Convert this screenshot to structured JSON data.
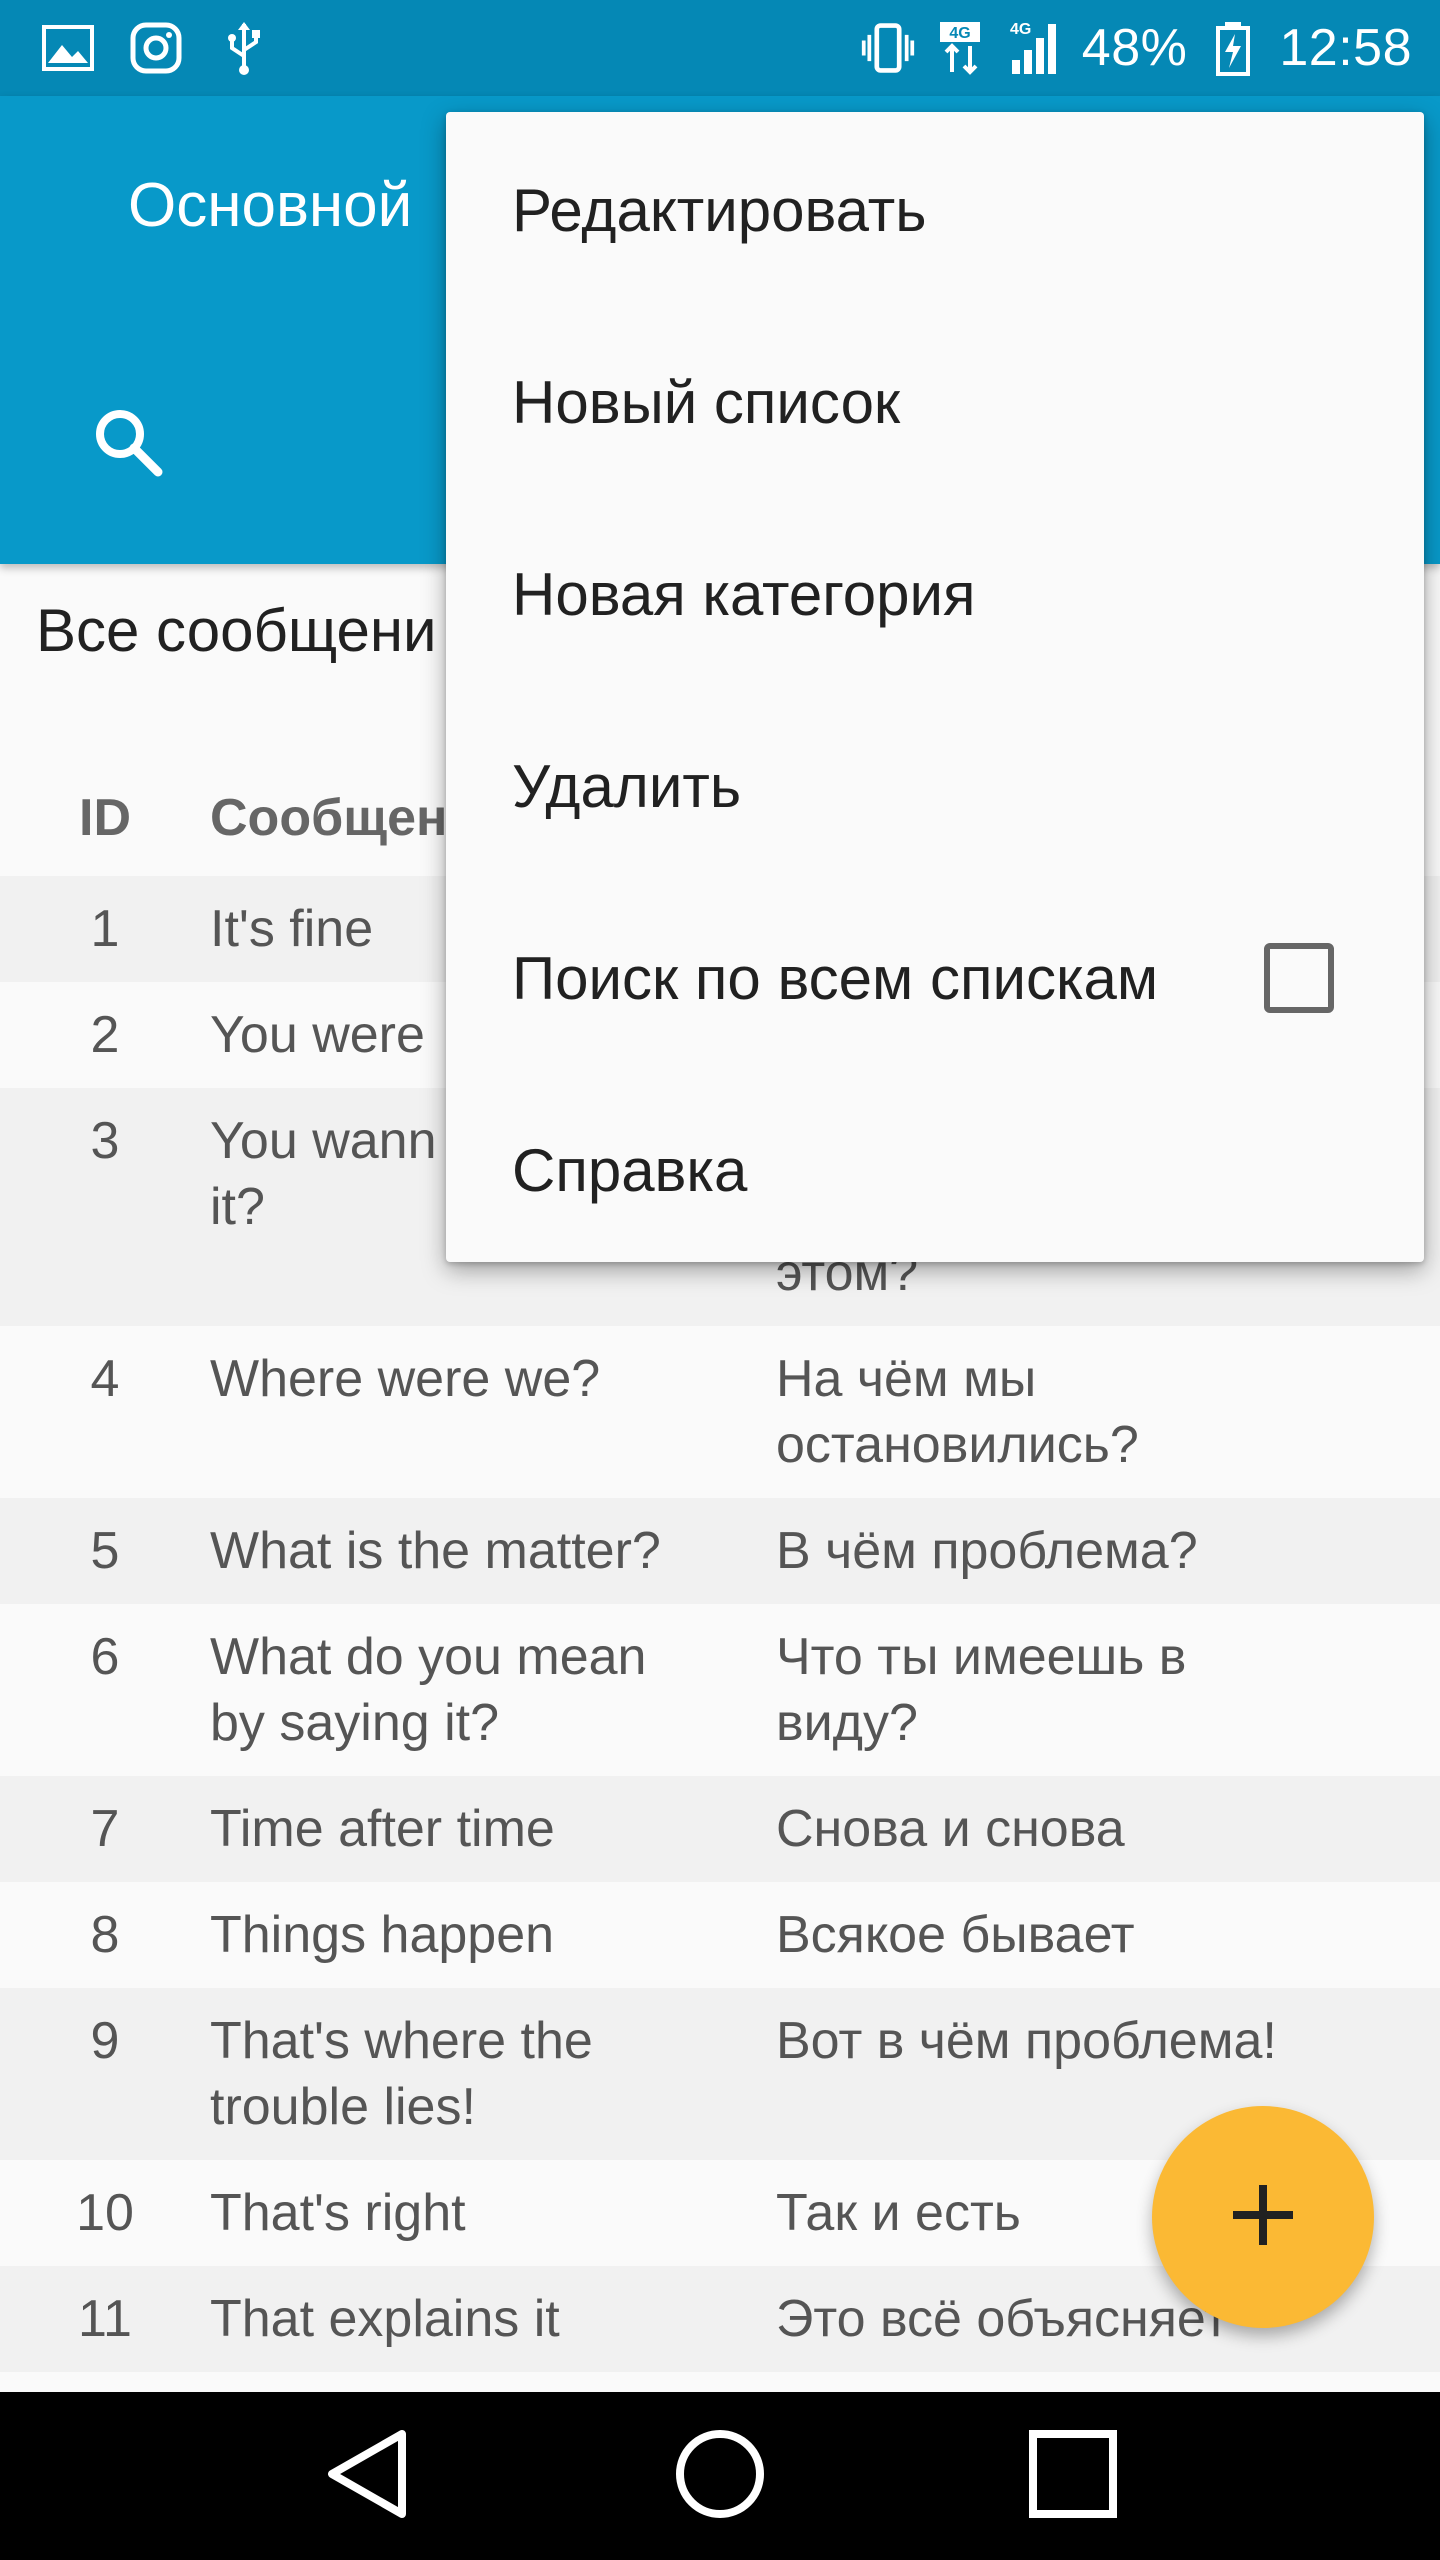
{
  "status_bar": {
    "battery_percent": "48%",
    "time": "12:58",
    "network_label": "4G",
    "left_icons": [
      "gallery-icon",
      "instagram-icon",
      "usb-icon"
    ],
    "right_icons": [
      "vibrate-icon",
      "data-transfer-icon",
      "signal-icon",
      "battery-charging-icon"
    ]
  },
  "app_bar": {
    "title": "Основной",
    "search_icon": "search-icon"
  },
  "content": {
    "section_heading": "Все сообщени",
    "table": {
      "headers": {
        "id": "ID",
        "message": "Сообщен"
      },
      "rows": [
        {
          "id": "1",
          "en": "It's fine",
          "ru": ""
        },
        {
          "id": "2",
          "en": "You were",
          "ru": ""
        },
        {
          "id": "3",
          "en": "You wann\nit?",
          "ru": "\n\nэтом?"
        },
        {
          "id": "4",
          "en": "Where were we?",
          "ru": "На чём мы\nостановились?"
        },
        {
          "id": "5",
          "en": "What is the matter?",
          "ru": "В чём проблема?"
        },
        {
          "id": "6",
          "en": "What do you mean\nby saying it?",
          "ru": "Что ты имеешь в\nвиду?"
        },
        {
          "id": "7",
          "en": "Time after time",
          "ru": "Снова и снова"
        },
        {
          "id": "8",
          "en": "Things happen",
          "ru": "Всякое бывает"
        },
        {
          "id": "9",
          "en": "That's where the\ntrouble lies!",
          "ru": "Вот в чём проблема!"
        },
        {
          "id": "10",
          "en": "That's right",
          "ru": "Так и есть"
        },
        {
          "id": "11",
          "en": "That explains it",
          "ru": "Это всё объясняет"
        }
      ]
    }
  },
  "menu": {
    "items": [
      {
        "label": "Редактировать"
      },
      {
        "label": "Новый список"
      },
      {
        "label": "Новая категория"
      },
      {
        "label": "Удалить"
      },
      {
        "label": "Поиск по всем спискам",
        "checkbox": true,
        "checked": false
      },
      {
        "label": "Справка"
      }
    ]
  },
  "fab": {
    "icon": "plus-icon"
  },
  "nav_bar": {
    "icons": [
      "back-icon",
      "home-icon",
      "recents-icon"
    ]
  },
  "colors": {
    "status_bar": "#0588b5",
    "app_bar": "#0899c9",
    "fab": "#fbb934",
    "row_alt": "#f1f1f1"
  }
}
